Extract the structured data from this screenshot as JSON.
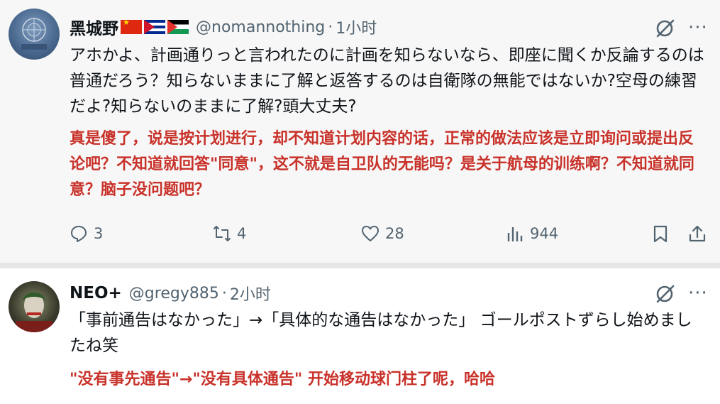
{
  "tweets": [
    {
      "author": "黑城野",
      "flags": [
        "china-flag",
        "cuba-flag",
        "palestine-flag"
      ],
      "handle": "@nomannothing",
      "separator": "·",
      "time": "1小时",
      "text": "アホかよ、計画通りっと言われたのに計画を知らないなら、即座に聞くか反論するのは普通だろう？知らないままに了解と返答するのは自衛隊の無能ではないか?空母の練習だよ?知らないのままに了解?頭大丈夫?",
      "translation": "真是傻了，说是按计划进行，却不知道计划内容的话，正常的做法应该是立即询问或提出反论吧？不知道就回答\"同意\"，这不就是自卫队的无能吗？是关于航母的训练啊？不知道就同意？脑子没问题吧？",
      "stats": {
        "replies": "3",
        "retweets": "4",
        "likes": "28",
        "views": "944"
      }
    },
    {
      "author": "NEO+",
      "handle": "@gregy885",
      "separator": "·",
      "time": "2小时",
      "text": "「事前通告はなかった」→「具体的な通告はなかった」 ゴールポストずらし始めましたね笑",
      "translation": "\"没有事先通告\"→\"没有具体通告\" 开始移动球门柱了呢，哈哈"
    }
  ],
  "colors": {
    "background": "#f7f7f7",
    "secondary_text": "#536471",
    "translation_text": "#c8322a",
    "primary_text": "#0f1419"
  },
  "icons": {
    "grok": "grok-icon",
    "more": "more-icon",
    "reply": "reply-icon",
    "retweet": "retweet-icon",
    "like": "like-icon",
    "views": "views-icon",
    "bookmark": "bookmark-icon",
    "share": "share-icon"
  }
}
